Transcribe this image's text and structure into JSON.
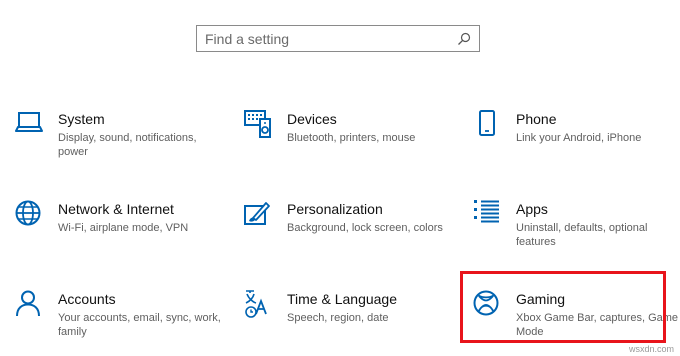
{
  "search": {
    "placeholder": "Find a setting"
  },
  "tiles": [
    {
      "title": "System",
      "desc": "Display, sound, notifications, power",
      "icon": "laptop-icon"
    },
    {
      "title": "Devices",
      "desc": "Bluetooth, printers, mouse",
      "icon": "devices-icon"
    },
    {
      "title": "Phone",
      "desc": "Link your Android, iPhone",
      "icon": "phone-icon"
    },
    {
      "title": "Network & Internet",
      "desc": "Wi-Fi, airplane mode, VPN",
      "icon": "globe-icon"
    },
    {
      "title": "Personalization",
      "desc": "Background, lock screen, colors",
      "icon": "paint-icon"
    },
    {
      "title": "Apps",
      "desc": "Uninstall, defaults, optional features",
      "icon": "apps-list-icon"
    },
    {
      "title": "Accounts",
      "desc": "Your accounts, email, sync, work, family",
      "icon": "person-icon"
    },
    {
      "title": "Time & Language",
      "desc": "Speech, region, date",
      "icon": "time-language-icon"
    },
    {
      "title": "Gaming",
      "desc": "Xbox Game Bar, captures, Game Mode",
      "icon": "xbox-icon"
    }
  ],
  "watermark": "wsxdn.com",
  "colors": {
    "accent": "#0063b1",
    "highlight": "#e8141b"
  }
}
